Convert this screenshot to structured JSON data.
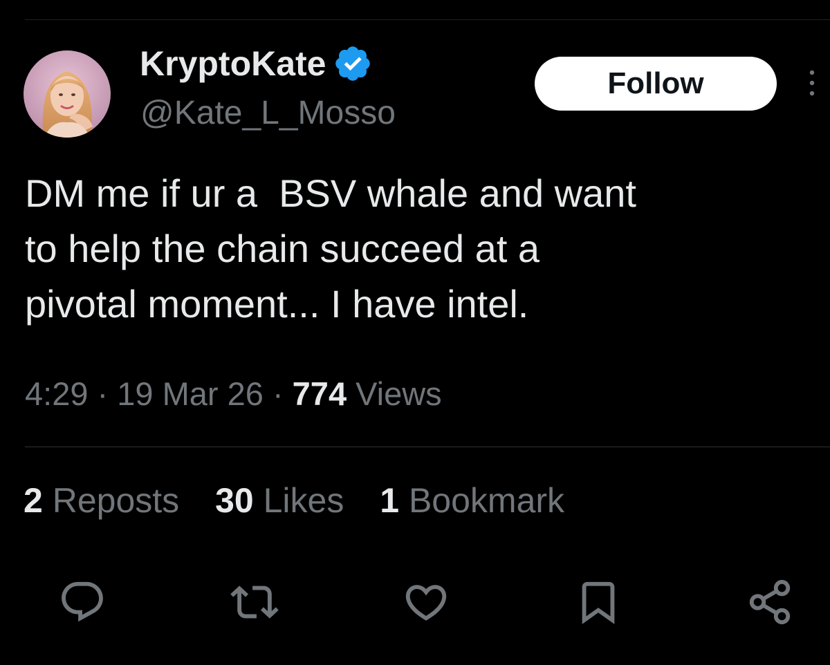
{
  "author": {
    "display_name": "KryptoKate",
    "handle": "@Kate_L_Mosso",
    "verified_icon": "verified-badge-icon",
    "verified_color": "#1d9bf0",
    "avatar": "profile-photo"
  },
  "follow_button": {
    "label": "Follow"
  },
  "more_menu_icon": "more-vertical-icon",
  "tweet": {
    "text": "DM me if ur a  BSV whale and want\nto help the chain succeed at a\npivotal moment... I have intel.",
    "time": "4:29",
    "date": "19 Mar 26",
    "separator": "·",
    "views_count": "774",
    "views_label": "Views"
  },
  "stats": {
    "reposts_count": "2",
    "reposts_label": "Reposts",
    "likes_count": "30",
    "likes_label": "Likes",
    "bookmarks_count": "1",
    "bookmarks_label": "Bookmark"
  },
  "actions": [
    {
      "icon": "reply-icon"
    },
    {
      "icon": "repost-icon"
    },
    {
      "icon": "like-icon"
    },
    {
      "icon": "bookmark-icon"
    },
    {
      "icon": "share-icon"
    }
  ],
  "colors": {
    "background": "#000000",
    "primary_text": "#e7e9ea",
    "secondary_text": "#71767b",
    "divider": "#2f3336",
    "accent": "#1d9bf0"
  }
}
